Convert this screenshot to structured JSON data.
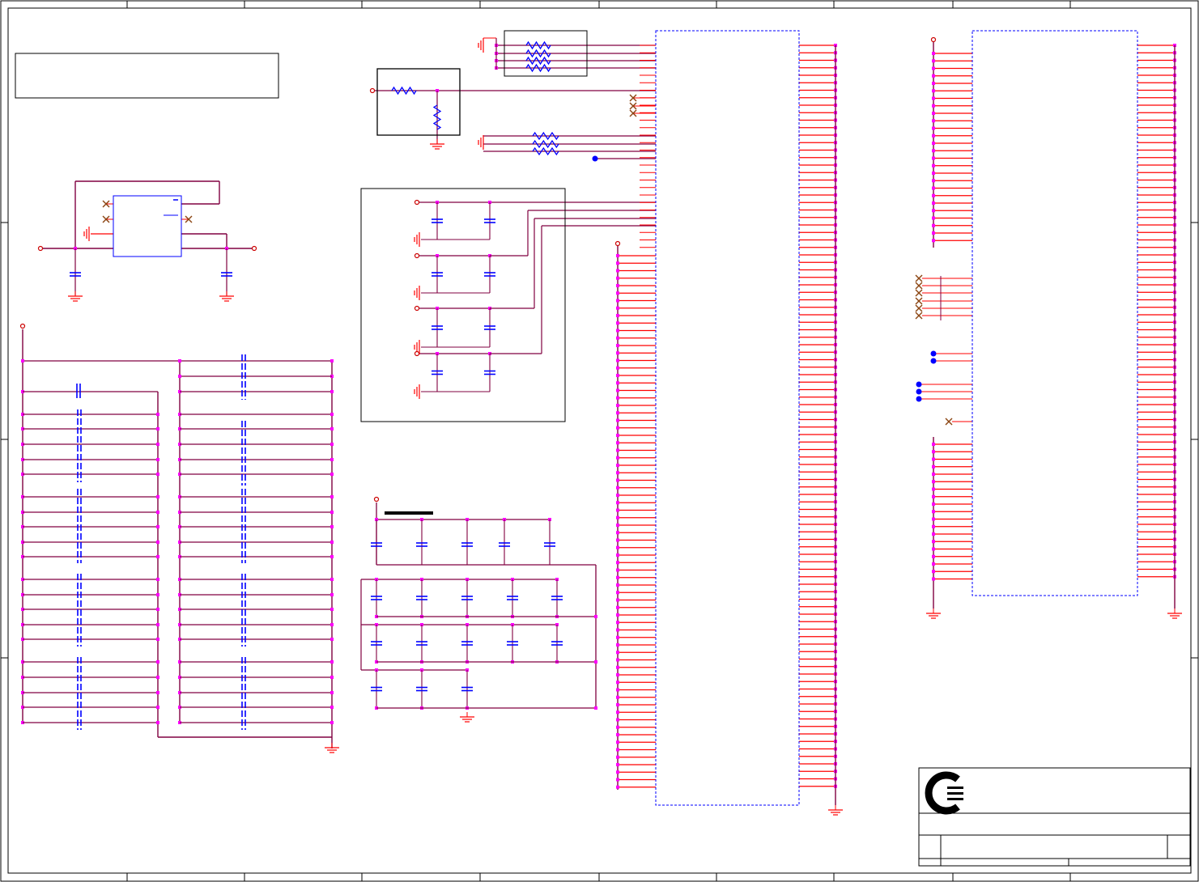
{
  "sheet": {
    "title": "",
    "colors": {
      "frame": "#000000",
      "wire": "#800040",
      "pin": "#ff0000",
      "component": "#0000ff",
      "junction": "#ff00ff",
      "noconnect": "#8b4513",
      "port": "#cc0000"
    },
    "title_block": {
      "logo_icon": "company-logo-icon",
      "fields": [
        "",
        "",
        "",
        ""
      ]
    },
    "icons": [
      "ground-icon",
      "capacitor-icon",
      "resistor-icon",
      "no-connect-icon",
      "junction-icon",
      "power-port-icon"
    ]
  }
}
